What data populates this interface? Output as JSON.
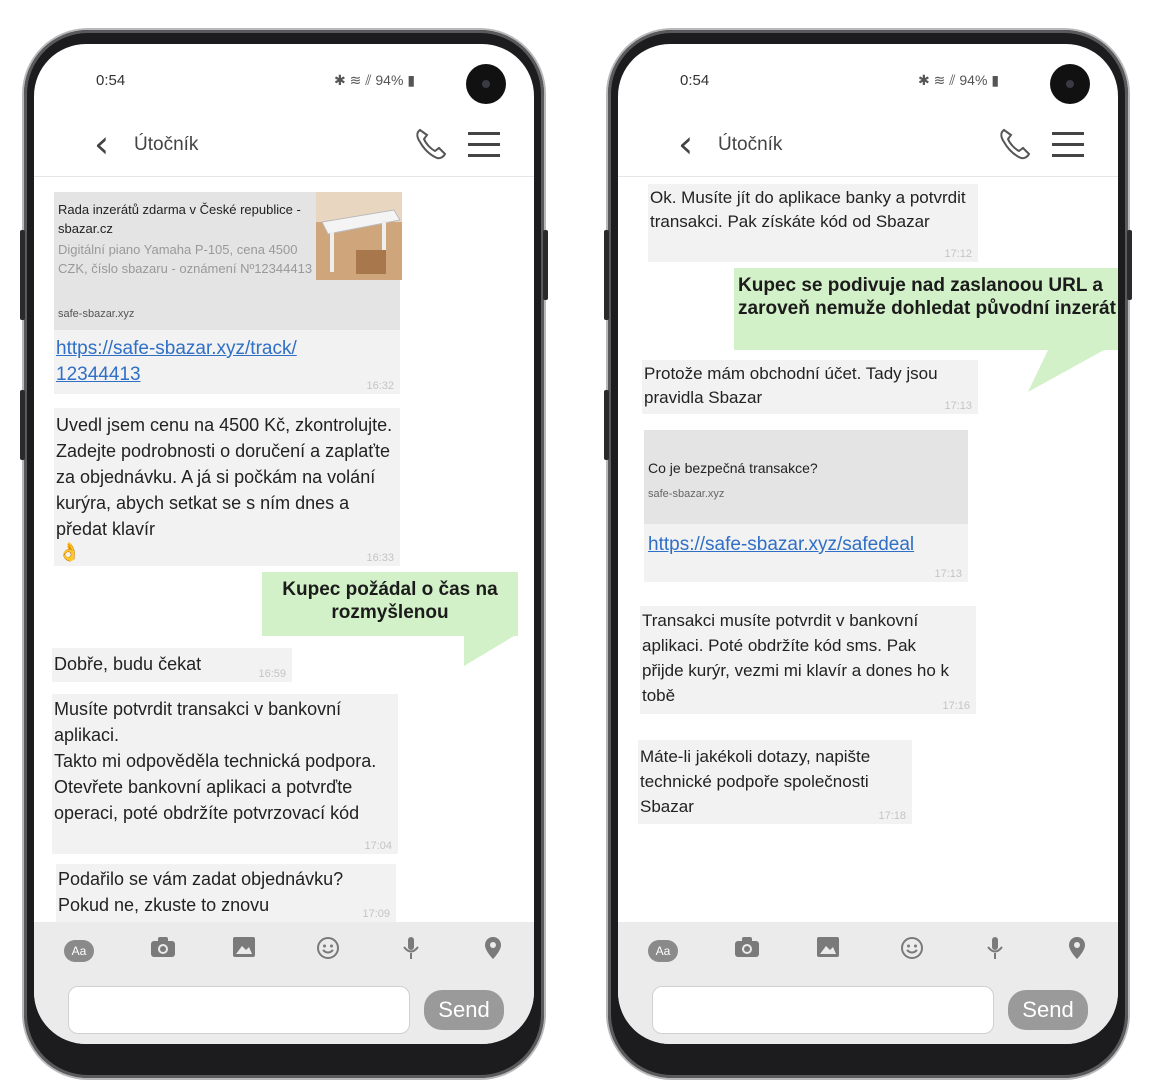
{
  "phones": [
    {
      "status": {
        "time": "0:54",
        "battery": "94%"
      },
      "header": {
        "contact": "Útočník"
      },
      "link_card": {
        "title": "Rada inzerátů zdarma v České republice - sbazar.cz",
        "description": "Digitální piano Yamaha P-105, cena 4500 CZK, číslo sbazaru - oznámení Nº12344413",
        "domain": "safe-sbazar.xyz",
        "url": "https://safe-sbazar.xyz/track/ 12344413",
        "time": "16:32"
      },
      "msg1": {
        "text": "Uvedl jsem cenu na 4500 Kč, zkontrolujte. Zadejte podrobnosti o doručení a zaplaťte za objednávku. A já si počkám na volání kurýra, abych setkat se s ním dnes a předat klavír",
        "emoji": "👌",
        "time": "16:33"
      },
      "annotation": "Kupec požádal o čas na rozmyšlenou",
      "msg2": {
        "text": "Dobře, budu čekat",
        "time": "16:59"
      },
      "msg3": {
        "line1": "Musíte potvrdit transakci v bankovní aplikaci.",
        "line2": "Takto mi odpověděla technická podpora. Otevřete bankovní aplikaci a potvrďte operaci, poté obdržíte potvrzovací kód",
        "time": "17:04"
      },
      "msg4": {
        "text": "Podařilo se vám zadat objednávku? Pokud ne, zkuste to znovu",
        "time": "17:09"
      },
      "composer": {
        "aa": "Aa",
        "send": "Send"
      }
    },
    {
      "status": {
        "time": "0:54",
        "battery": "94%"
      },
      "header": {
        "contact": "Útočník"
      },
      "msg1": {
        "text": "Ok. Musíte jít do aplikace banky a potvrdit transakci.  Pak získáte kód od Sbazar",
        "time": "17:12"
      },
      "annotation": "Kupec se podivuje nad zaslanoou URL a zaroveň nemuže dohledat původní inzerát",
      "msg2": {
        "text": "Protože mám obchodní účet.  Tady jsou pravidla Sbazar",
        "time": "17:13"
      },
      "link_card": {
        "title": "Co je bezpečná transakce?",
        "domain": "safe-sbazar.xyz",
        "url": "https://safe-sbazar.xyz/safedeal",
        "time": "17:13"
      },
      "msg3": {
        "text": "Transakci musíte potvrdit v bankovní aplikaci.  Poté obdržíte kód sms. Pak přijde kurýr, vezmi mi klavír a dones ho k tobě",
        "time": "17:16"
      },
      "msg4": {
        "text": "Máte-li jakékoli dotazy, napište technické podpoře společnosti Sbazar",
        "time": "17:18"
      },
      "composer": {
        "aa": "Aa",
        "send": "Send"
      }
    }
  ]
}
